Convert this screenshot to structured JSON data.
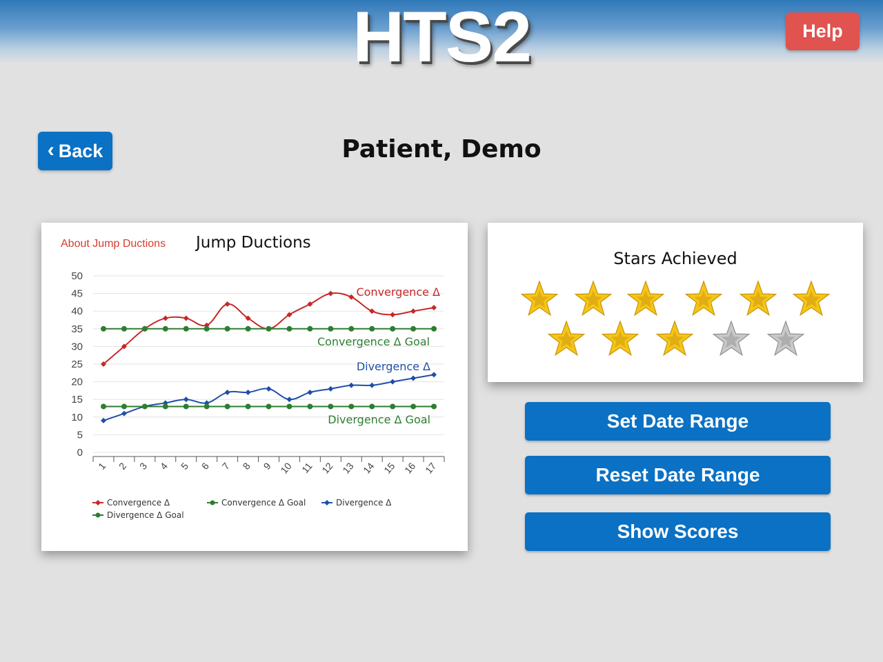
{
  "app": {
    "logo_text": "HTS2"
  },
  "header": {
    "help_label": "Help"
  },
  "nav": {
    "back_label": "Back"
  },
  "patient": {
    "name": "Patient, Demo"
  },
  "chart_panel": {
    "about_link": "About Jump Ductions",
    "title": "Jump Ductions"
  },
  "chart_data": {
    "type": "line",
    "title": "Jump Ductions",
    "xlabel": "",
    "ylabel": "",
    "x": [
      1,
      2,
      3,
      4,
      5,
      6,
      7,
      8,
      9,
      10,
      11,
      12,
      13,
      14,
      15,
      16,
      17
    ],
    "ylim": [
      0,
      50
    ],
    "yticks": [
      0,
      5,
      10,
      15,
      20,
      25,
      30,
      35,
      40,
      45,
      50
    ],
    "grid": true,
    "legend_position": "bottom",
    "series": [
      {
        "name": "Convergence Δ",
        "color": "#c62828",
        "values": [
          25,
          30,
          35,
          38,
          38,
          36,
          42,
          38,
          35,
          39,
          42,
          45,
          44,
          40,
          39,
          40,
          41
        ]
      },
      {
        "name": "Convergence Δ Goal",
        "color": "#2e7d32",
        "values": [
          35,
          35,
          35,
          35,
          35,
          35,
          35,
          35,
          35,
          35,
          35,
          35,
          35,
          35,
          35,
          35,
          35
        ]
      },
      {
        "name": "Divergence Δ",
        "color": "#1e4fa8",
        "values": [
          9,
          11,
          13,
          14,
          15,
          14,
          17,
          17,
          18,
          15,
          17,
          18,
          19,
          19,
          20,
          21,
          22
        ]
      },
      {
        "name": "Divergence Δ Goal",
        "color": "#2e7d32",
        "values": [
          13,
          13,
          13,
          13,
          13,
          13,
          13,
          13,
          13,
          13,
          13,
          13,
          13,
          13,
          13,
          13,
          13
        ]
      }
    ],
    "annotations": [
      "Convergence Δ",
      "Convergence Δ Goal",
      "Divergence Δ",
      "Divergence Δ Goal"
    ]
  },
  "stars": {
    "title": "Stars Achieved",
    "total": 11,
    "achieved": 9,
    "gold_color": "#f5c518",
    "silver_color": "#c9c9c9"
  },
  "actions": {
    "set_date_range": "Set Date Range",
    "reset_date_range": "Reset Date Range",
    "show_scores": "Show Scores"
  },
  "colors": {
    "accent": "#0a71c4",
    "help": "#e0534f"
  }
}
